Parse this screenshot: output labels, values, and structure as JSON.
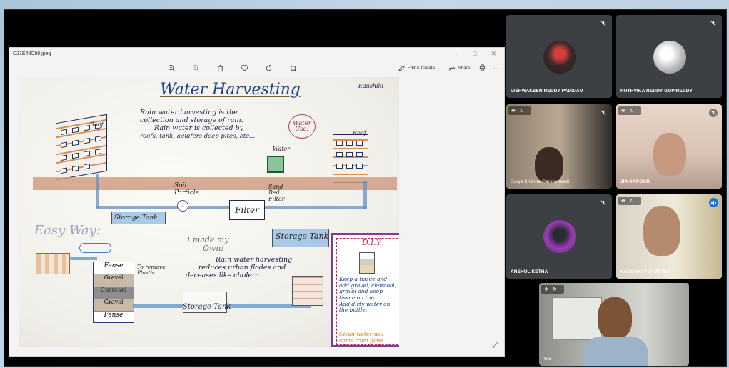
{
  "viewer": {
    "filename": "C21E48C98.jpeg",
    "toolbar": {
      "edit_create": "Edit & Create",
      "share": "Share"
    }
  },
  "poster": {
    "title": "Water Harvesting",
    "author": "-Kaushiki",
    "definition": [
      "Rain water harvesting is the",
      "collection and storage of rain.",
      "Rain water is collected by",
      "roofs, tank, aquifers deep pites, etc..."
    ],
    "roof_label": "Roof",
    "roof_label_2": "Roof",
    "water_use": [
      "Water",
      "Use!"
    ],
    "water_label": "Water",
    "soil_particle": [
      "Soil",
      "Particle"
    ],
    "sand_bed_filter": [
      "Sand",
      "Bed",
      "Filter"
    ],
    "storage_tank_1": "Storage Tank",
    "filter": "Filter",
    "storage_tank_2": "Storage Tank",
    "easy_way": "Easy Way:",
    "made_own": [
      "I made my",
      "Own!"
    ],
    "benefit": [
      "Rain water harvesting",
      "reduces urban flodes and",
      "deceases like cholera."
    ],
    "to_remove": [
      "To remove",
      "Plastic"
    ],
    "fense_layers": [
      "Fense",
      "Gravel",
      "Charcoal",
      "Gravel",
      "Fense"
    ],
    "storage_tank_3": "Storage Tank",
    "diy_title": "D.I.Y",
    "diy_steps": [
      "Keep a tissue and",
      "add gravel, charcoal,",
      "gravel and keep",
      "tissue on top.",
      "Add dirty water on",
      "the bottle."
    ],
    "diy_result": [
      "Clean water will",
      "come from glass."
    ]
  },
  "participants": [
    {
      "name": "VISHWAKSEN REDDY PADIDAM",
      "muted": true,
      "avatar_color": "#2b2b2b"
    },
    {
      "name": "RUTHVIKA REDDY GOPIREDDY",
      "muted": true,
      "avatar_color": "#d9d9d9"
    },
    {
      "name": "Surya Krishna Gaddameedi",
      "muted": true
    },
    {
      "name": "JIA KAPOOR",
      "muted": true
    },
    {
      "name": "ANSHUL KETHA",
      "muted": true,
      "avatar_color": "#6a2a7a"
    },
    {
      "name": "KAUSHIKI PENMETSA",
      "speaking": true
    },
    {
      "name": "You"
    }
  ],
  "colors": {
    "meet_bg": "#000000",
    "tile_bg": "#3c4043",
    "active_outline": "#8ab4f8",
    "accent_blue": "#1a73e8"
  }
}
